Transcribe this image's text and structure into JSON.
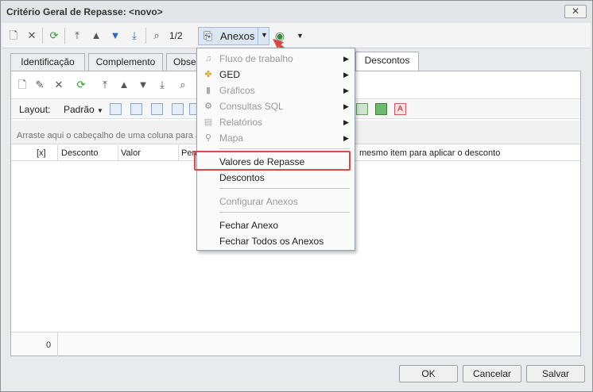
{
  "window": {
    "title": "Critério Geral de Repasse: <novo>",
    "close_glyph": "✕"
  },
  "toolbar": {
    "page_indicator": "1/2",
    "anexos_label": "Anexos"
  },
  "tabs": [
    {
      "label": "Identificação"
    },
    {
      "label": "Complemento"
    },
    {
      "label": "Obse"
    },
    {
      "label": "Descontos"
    }
  ],
  "layoutbar": {
    "layout_label": "Layout:",
    "layout_value": "Padrão"
  },
  "grid": {
    "group_hint": "Arraste aqui o cabeçalho de uma coluna para ag",
    "columns": [
      "[x]",
      "Desconto",
      "Valor",
      "Perc"
    ],
    "hint_tail": "mesmo item para aplicar o desconto",
    "footer_count": "0"
  },
  "menu": {
    "items": [
      {
        "label": "Fluxo de trabalho",
        "disabled": true,
        "submenu": true,
        "icon": "workflow-icon"
      },
      {
        "label": "GED",
        "disabled": false,
        "submenu": true,
        "icon": "ged-icon"
      },
      {
        "label": "Gráficos",
        "disabled": true,
        "submenu": true,
        "icon": "chart-icon"
      },
      {
        "label": "Consultas SQL",
        "disabled": true,
        "submenu": true,
        "icon": "sql-query-icon"
      },
      {
        "label": "Relatórios",
        "disabled": true,
        "submenu": true,
        "icon": "report-icon"
      },
      {
        "label": "Mapa",
        "disabled": true,
        "submenu": true,
        "icon": "map-pin-icon"
      },
      {
        "label": "Valores de Repasse",
        "disabled": false,
        "submenu": false
      },
      {
        "label": "Descontos",
        "disabled": false,
        "submenu": false
      },
      {
        "label": "Configurar Anexos",
        "disabled": true,
        "submenu": false
      },
      {
        "label": "Fechar Anexo",
        "disabled": false,
        "submenu": false
      },
      {
        "label": "Fechar Todos os Anexos",
        "disabled": false,
        "submenu": false
      }
    ]
  },
  "buttons": {
    "ok": "OK",
    "cancel": "Cancelar",
    "save": "Salvar"
  },
  "colors": {
    "highlight": "#e04848",
    "accent": "#dce6f2"
  }
}
